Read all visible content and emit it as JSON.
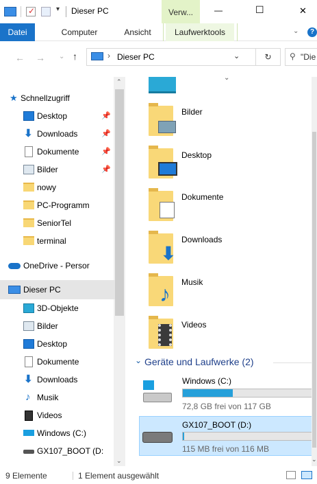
{
  "window": {
    "title": "Dieser PC",
    "context_tab": "Verw...",
    "min": "—",
    "max": "☐",
    "close": "✕"
  },
  "ribbon": {
    "tabs": [
      "Datei",
      "Computer",
      "Ansicht",
      "Laufwerktools"
    ]
  },
  "address": {
    "path": "Dieser PC",
    "search_placeholder": "\"Die"
  },
  "nav": {
    "quick_access": "Schnellzugriff",
    "quick_items": [
      "Desktop",
      "Downloads",
      "Dokumente",
      "Bilder",
      "nowy",
      "PC-Programm",
      "SeniorTel",
      "terminal"
    ],
    "onedrive": "OneDrive - Persor",
    "this_pc": "Dieser PC",
    "pc_items": [
      "3D-Objekte",
      "Bilder",
      "Desktop",
      "Dokumente",
      "Downloads",
      "Musik",
      "Videos",
      "Windows (C:)",
      "GX107_BOOT (D:"
    ]
  },
  "folders": [
    "Bilder",
    "Desktop",
    "Dokumente",
    "Downloads",
    "Musik",
    "Videos"
  ],
  "devices": {
    "header": "Geräte und Laufwerke (2)",
    "drives": [
      {
        "name": "Windows (C:)",
        "free": "72,8 GB frei von 117 GB",
        "fill": 0.38,
        "color": "#26a0da"
      },
      {
        "name": "GX107_BOOT (D:)",
        "free": "115 MB frei von 116 MB",
        "fill": 0.01,
        "color": "#26a0da"
      }
    ]
  },
  "status": {
    "count": "9 Elemente",
    "selected": "1 Element ausgewählt"
  }
}
